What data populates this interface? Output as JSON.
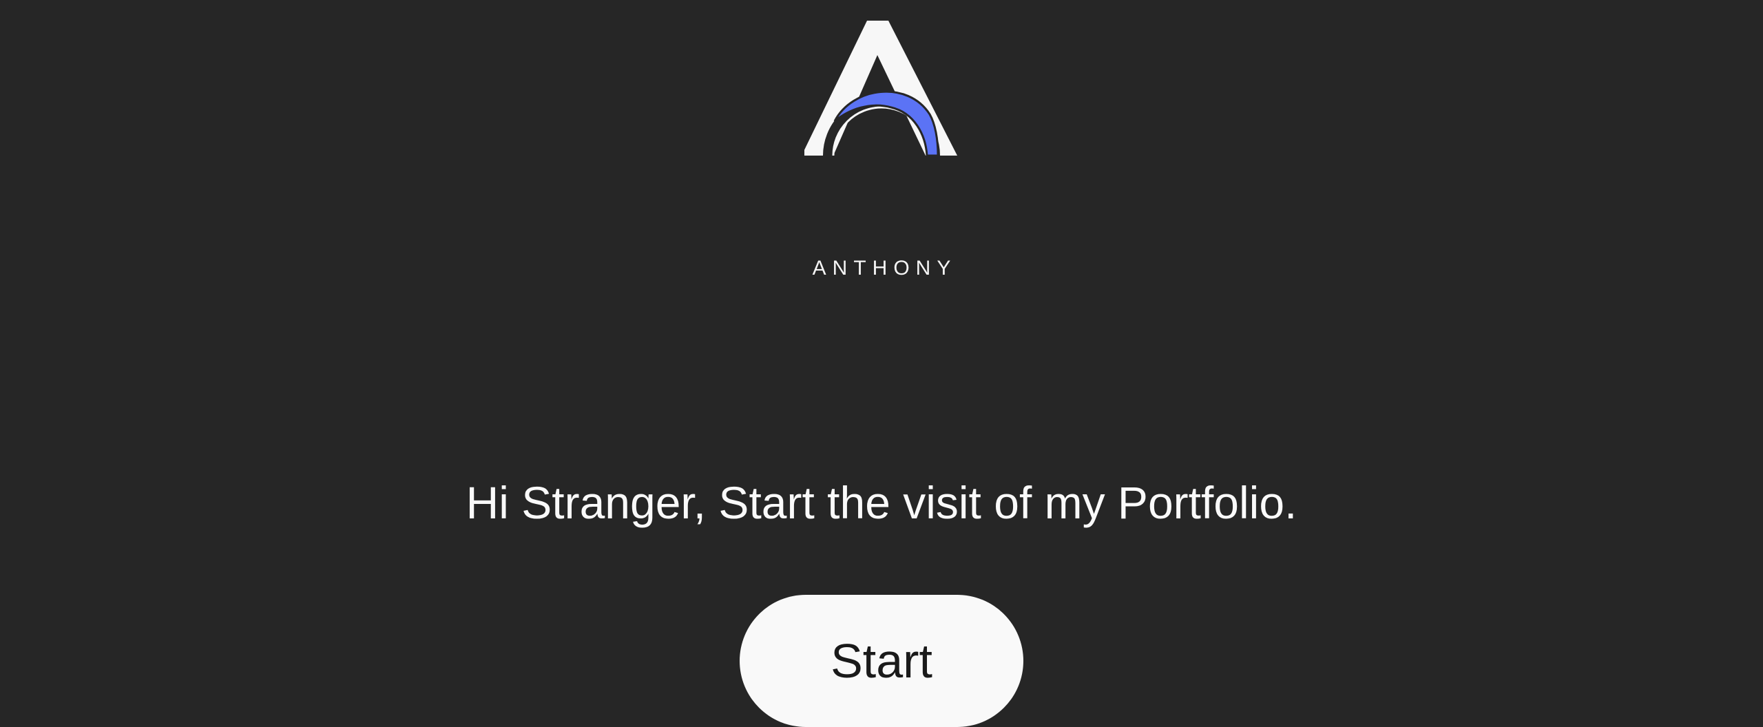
{
  "brand": {
    "name": "ANTHONY",
    "logo_icon": "anthony-a-arch-logo",
    "accent_color": "#5b73f5"
  },
  "hero": {
    "tagline": "Hi Stranger, Start the visit of my Portfolio.",
    "start_label": "Start"
  }
}
